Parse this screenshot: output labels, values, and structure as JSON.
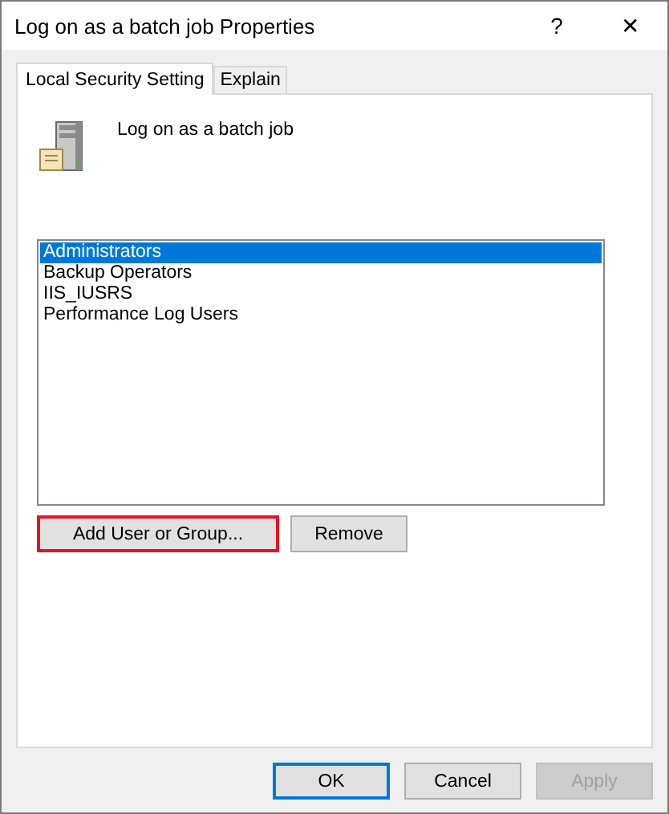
{
  "window": {
    "title": "Log on as a batch job Properties",
    "help": "?",
    "close": "✕"
  },
  "tabs": [
    {
      "label": "Local Security Setting",
      "selected": true
    },
    {
      "label": "Explain",
      "selected": false
    }
  ],
  "policy_name": "Log on as a batch job",
  "members": [
    {
      "name": "Administrators",
      "selected": true
    },
    {
      "name": "Backup Operators",
      "selected": false
    },
    {
      "name": "IIS_IUSRS",
      "selected": false
    },
    {
      "name": "Performance Log Users",
      "selected": false
    }
  ],
  "member_buttons": [
    {
      "label": "Add User or Group...",
      "highlighted": true
    },
    {
      "label": "Remove",
      "highlighted": false
    }
  ],
  "buttons": [
    {
      "label": "OK",
      "focused": true,
      "disabled": false
    },
    {
      "label": "Cancel",
      "focused": false,
      "disabled": false
    },
    {
      "label": "Apply",
      "focused": false,
      "disabled": true
    }
  ]
}
